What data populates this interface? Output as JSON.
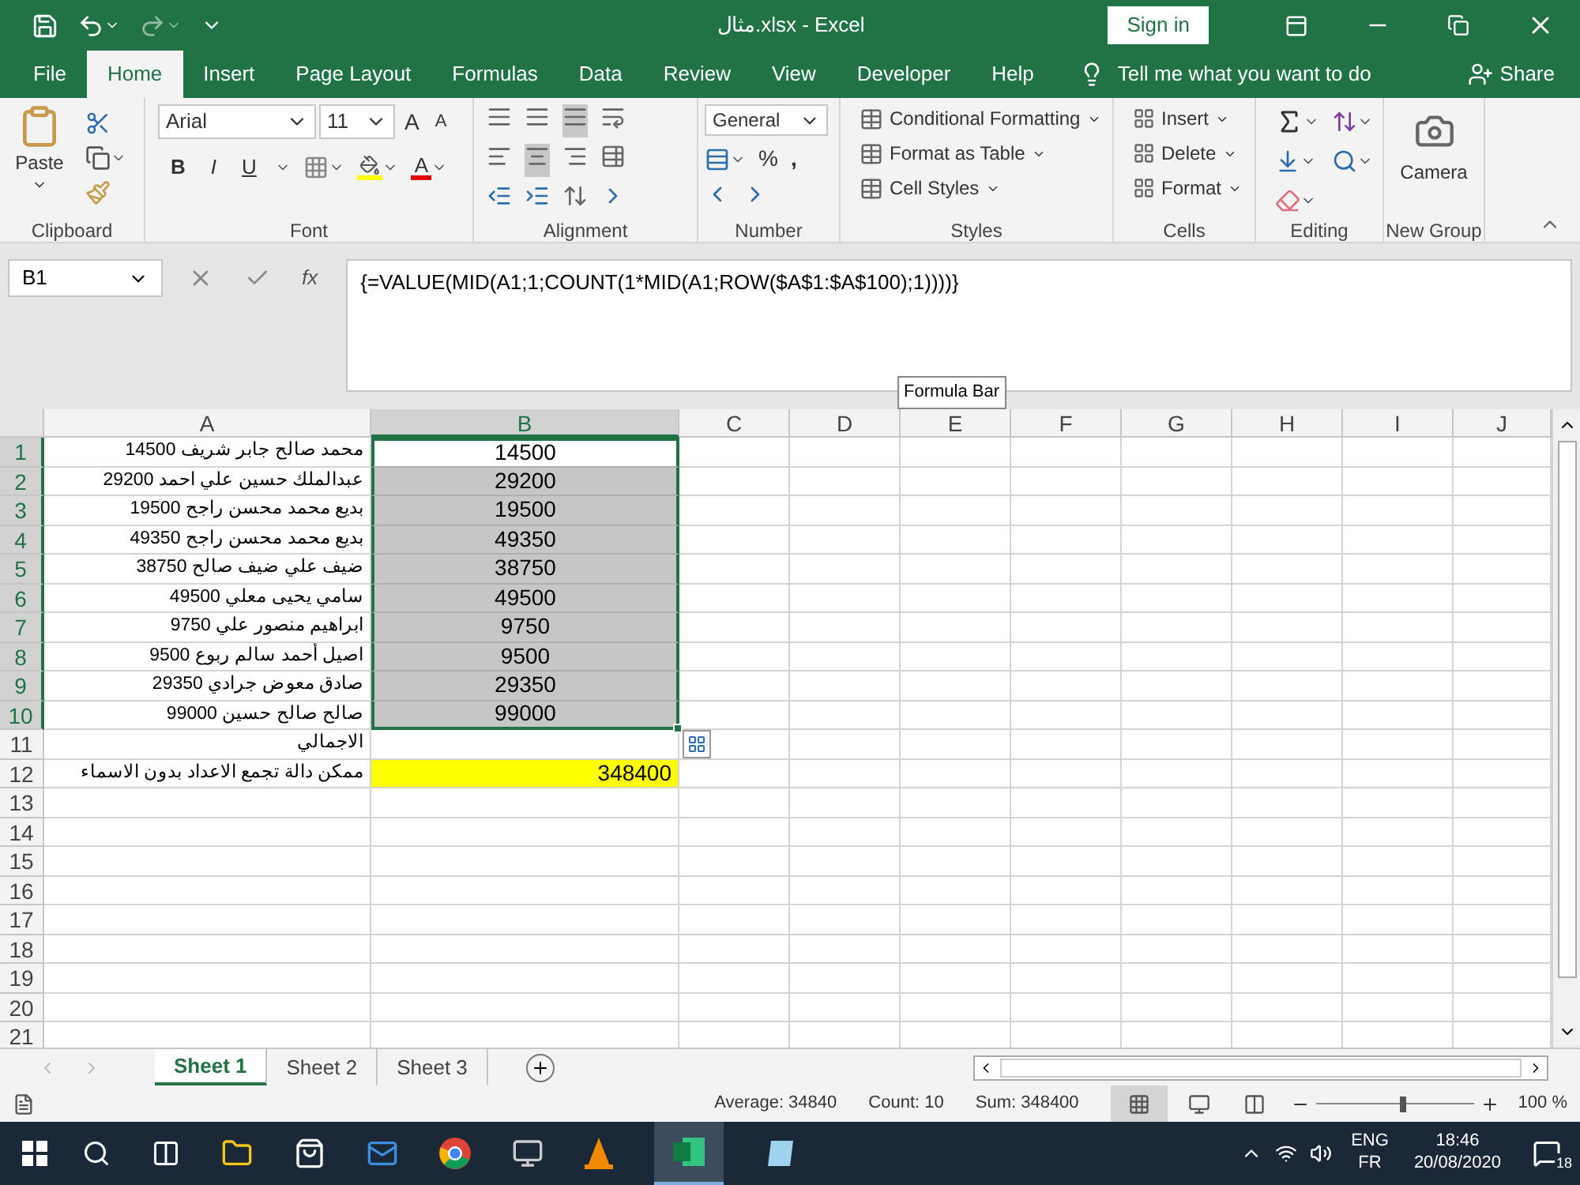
{
  "title_bar": {
    "title": "مثال.xlsx  -  Excel",
    "sign_in": "Sign in"
  },
  "menu_tabs": [
    {
      "label": "File",
      "selected": false
    },
    {
      "label": "Home",
      "selected": true
    },
    {
      "label": "Insert",
      "selected": false
    },
    {
      "label": "Page Layout",
      "selected": false
    },
    {
      "label": "Formulas",
      "selected": false
    },
    {
      "label": "Data",
      "selected": false
    },
    {
      "label": "Review",
      "selected": false
    },
    {
      "label": "View",
      "selected": false
    },
    {
      "label": "Developer",
      "selected": false
    },
    {
      "label": "Help",
      "selected": false
    }
  ],
  "tell_me": "Tell me what you want to do",
  "share": "Share",
  "ribbon": {
    "clipboard": {
      "paste": "Paste",
      "label": "Clipboard"
    },
    "font": {
      "font_name": "Arial",
      "font_size": "11",
      "grow": "A",
      "shrink": "A",
      "bold": "B",
      "italic": "I",
      "underline": "U",
      "font_color": "A",
      "label": "Font"
    },
    "alignment": {
      "label": "Alignment"
    },
    "number": {
      "format": "General",
      "percent": "%",
      "comma": ",",
      "label": "Number"
    },
    "styles": {
      "buttons": [
        "Conditional Formatting",
        "Format as Table",
        "Cell Styles"
      ],
      "label": "Styles"
    },
    "cells": {
      "buttons": [
        "Insert",
        "Delete",
        "Format"
      ],
      "label": "Cells"
    },
    "editing": {
      "label": "Editing"
    },
    "new_group": {
      "camera": "Camera",
      "label": "New Group"
    }
  },
  "formula_bar": {
    "name_box": "B1",
    "fx": "fx",
    "formula": "{=VALUE(MID(A1;1;COUNT(1*MID(A1;ROW($A$1:$A$100);1))))}",
    "tooltip": "Formula Bar"
  },
  "columns": [
    {
      "label": "A",
      "selected": false
    },
    {
      "label": "B",
      "selected": true
    },
    {
      "label": "C",
      "selected": false
    },
    {
      "label": "D",
      "selected": false
    },
    {
      "label": "E",
      "selected": false
    },
    {
      "label": "F",
      "selected": false
    },
    {
      "label": "G",
      "selected": false
    },
    {
      "label": "H",
      "selected": false
    },
    {
      "label": "I",
      "selected": false
    },
    {
      "label": "J",
      "selected": false
    }
  ],
  "rows": [
    {
      "header": "1",
      "selected": true,
      "cells": [
        {
          "text": "محمد صالح جابر شريف 14500"
        },
        {
          "text": "14500",
          "selected": true,
          "active": true
        }
      ]
    },
    {
      "header": "2",
      "selected": true,
      "cells": [
        {
          "text": "عبدالملك حسين علي احمد 29200"
        },
        {
          "text": "29200",
          "selected": true,
          "active": false
        }
      ]
    },
    {
      "header": "3",
      "selected": true,
      "cells": [
        {
          "text": "بديع محمد محسن راجح 19500"
        },
        {
          "text": "19500",
          "selected": true,
          "active": false
        }
      ]
    },
    {
      "header": "4",
      "selected": true,
      "cells": [
        {
          "text": "بديع محمد محسن راجح 49350"
        },
        {
          "text": "49350",
          "selected": true,
          "active": false
        }
      ]
    },
    {
      "header": "5",
      "selected": true,
      "cells": [
        {
          "text": "ضيف علي ضيف صالح 38750"
        },
        {
          "text": "38750",
          "selected": true,
          "active": false
        }
      ]
    },
    {
      "header": "6",
      "selected": true,
      "cells": [
        {
          "text": "سامي يحيى معلي 49500"
        },
        {
          "text": "49500",
          "selected": true,
          "active": false
        }
      ]
    },
    {
      "header": "7",
      "selected": true,
      "cells": [
        {
          "text": "ابراهيم منصور علي 9750"
        },
        {
          "text": "9750",
          "selected": true,
          "active": false
        }
      ]
    },
    {
      "header": "8",
      "selected": true,
      "cells": [
        {
          "text": "اصيل أحمد سالم ربوع 9500"
        },
        {
          "text": "9500",
          "selected": true,
          "active": false
        }
      ]
    },
    {
      "header": "9",
      "selected": true,
      "cells": [
        {
          "text": "صادق معوض جرادي 29350"
        },
        {
          "text": "29350",
          "selected": true,
          "active": false
        }
      ]
    },
    {
      "header": "10",
      "selected": true,
      "cells": [
        {
          "text": "صالح صالح حسين 99000"
        },
        {
          "text": "99000",
          "selected": true,
          "active": false
        }
      ]
    },
    {
      "header": "11",
      "selected": false,
      "cells": [
        {
          "text": "الاجمالي"
        }
      ]
    },
    {
      "header": "12",
      "selected": false,
      "cells": [
        {
          "text": "ممكن دالة تجمع الاعداد بدون الاسماء"
        },
        {
          "text": "348400",
          "selected": false,
          "color": "#ffff00"
        }
      ]
    },
    {
      "header": "13",
      "selected": false
    },
    {
      "header": "14",
      "selected": false
    },
    {
      "header": "15",
      "selected": false
    },
    {
      "header": "16",
      "selected": false
    },
    {
      "header": "17",
      "selected": false
    },
    {
      "header": "18",
      "selected": false
    },
    {
      "header": "19",
      "selected": false
    },
    {
      "header": "20",
      "selected": false
    },
    {
      "header": "21",
      "selected": false
    }
  ],
  "sheet_tabs": [
    {
      "label": "Sheet 1",
      "selected": true
    },
    {
      "label": "Sheet 2",
      "selected": false
    },
    {
      "label": "Sheet 3",
      "selected": false
    }
  ],
  "status_bar": {
    "average": "Average: 34840",
    "count": "Count: 10",
    "sum": "Sum: 348400",
    "zoom": {
      "reading": "100 %",
      "level": 0.55
    }
  },
  "taskbar": {
    "language": "ENG",
    "keyboard": "FR",
    "time": "18:46",
    "date": "20/08/2020",
    "notifications": "18"
  }
}
